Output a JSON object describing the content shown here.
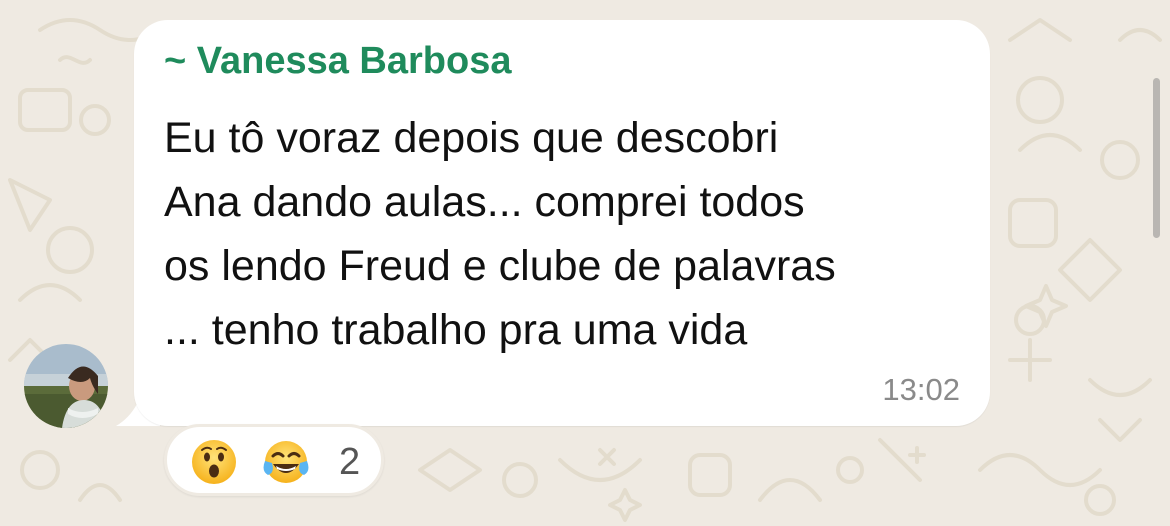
{
  "message": {
    "sender": "~ Vanessa Barbosa",
    "lines": [
      "Eu tô voraz depois que descobri",
      "Ana dando aulas... comprei todos",
      "os lendo Freud e clube de palavras",
      "... tenho trabalho pra uma vida"
    ],
    "time": "13:02"
  },
  "reactions": {
    "emojis": [
      "astonished-face",
      "face-with-tears-of-joy"
    ],
    "count": "2"
  },
  "colors": {
    "background": "#efeae2",
    "bubble": "#ffffff",
    "sender": "#1f8b5c",
    "text": "#111111",
    "time": "#8a8a8a"
  }
}
